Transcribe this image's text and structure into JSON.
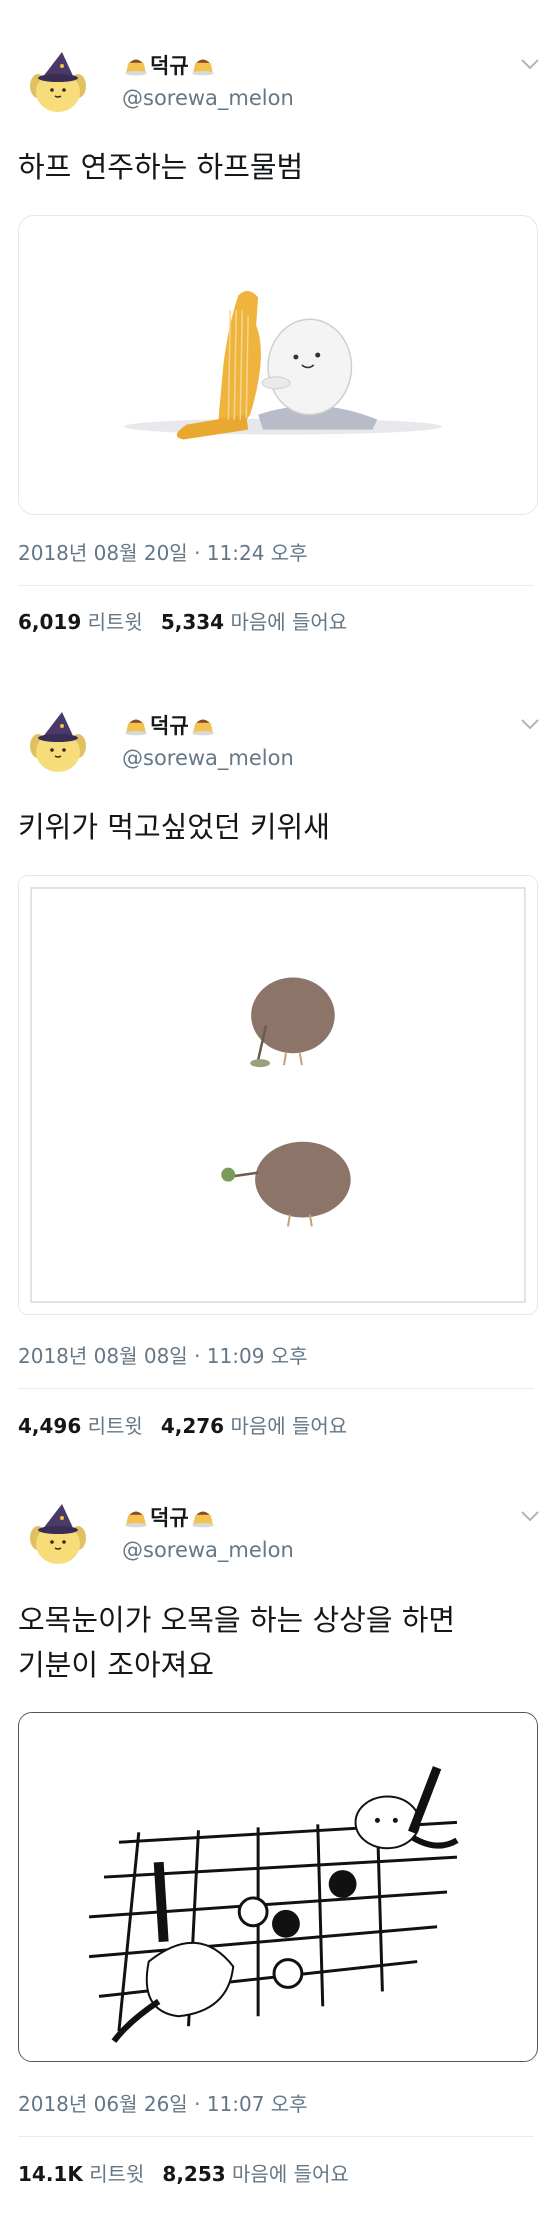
{
  "colors": {
    "text": "#14171a",
    "secondary": "#657786",
    "divider": "#e6ecf0"
  },
  "icons": {
    "avatar": "pompompurin-witch-hat-avatar",
    "name_emoji": "custard-pudding-emoji",
    "menu": "chevron-down-icon"
  },
  "tweets": [
    {
      "display_name": "덕규",
      "handle": "@sorewa_melon",
      "text_lines": [
        "하프 연주하는 하프물범"
      ],
      "timestamp": "2018년 08월 20일 · 11:24 오후",
      "retweets": "6,019",
      "retweets_label": "리트윗",
      "likes": "5,334",
      "likes_label": "마음에 들어요",
      "media": "harp-seal-playing-harp-illustration"
    },
    {
      "display_name": "덕규",
      "handle": "@sorewa_melon",
      "text_lines": [
        "키위가 먹고싶었던 키위새"
      ],
      "timestamp": "2018년 08월 08일 · 11:09 오후",
      "retweets": "4,496",
      "retweets_label": "리트윗",
      "likes": "4,276",
      "likes_label": "마음에 들어요",
      "media": "kiwi-birds-illustration"
    },
    {
      "display_name": "덕규",
      "handle": "@sorewa_melon",
      "text_lines": [
        "오목눈이가 오목을 하는 상상을 하면",
        "기분이 조아져요"
      ],
      "timestamp": "2018년 06월 26일 · 11:07 오후",
      "retweets": "14.1K",
      "retweets_label": "리트윗",
      "likes": "8,253",
      "likes_label": "마음에 들어요",
      "media": "long-tailed-tits-playing-omok-illustration"
    }
  ]
}
